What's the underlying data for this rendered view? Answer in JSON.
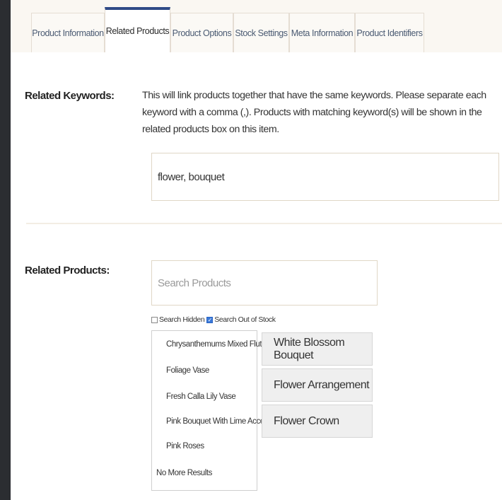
{
  "tabs": [
    {
      "label": "Product Information"
    },
    {
      "label": "Related Products",
      "active": true
    },
    {
      "label": "Product Options"
    },
    {
      "label": "Stock Settings"
    },
    {
      "label": "Meta Information"
    },
    {
      "label": "Product Identifiers"
    }
  ],
  "keywords": {
    "label": "Related Keywords:",
    "description": "This will link products together that have the same keywords. Please separate each keyword with a comma (,). Products with matching keyword(s) will be shown in the related products box on this item.",
    "value": "flower, bouquet"
  },
  "related_products": {
    "label": "Related Products:",
    "search_placeholder": "Search Products",
    "search_hidden_label": "Search Hidden",
    "search_hidden_checked": false,
    "search_out_of_stock_label": "Search Out of Stock",
    "search_out_of_stock_checked": true,
    "results": [
      "Chrysanthemums Mixed Flute",
      "Foliage Vase",
      "Fresh Calla Lily Vase",
      "Pink Bouquet With Lime Accents",
      "Pink Roses"
    ],
    "no_more_results": "No More Results",
    "selected": [
      "White Blossom Bouquet",
      "Flower Arrangement",
      "Flower Crown"
    ]
  },
  "colors": {
    "accent": "#2f4a86",
    "checkbox": "#3b79d8",
    "chip_bg": "#efefef"
  }
}
